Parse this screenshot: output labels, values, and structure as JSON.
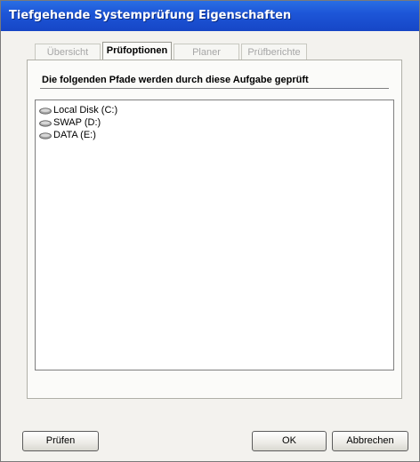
{
  "window": {
    "title": "Tiefgehende Systemprüfung Eigenschaften"
  },
  "tabs": [
    {
      "label": "Übersicht",
      "active": false
    },
    {
      "label": "Prüfoptionen",
      "active": true
    },
    {
      "label": "Planer",
      "active": false
    },
    {
      "label": "Prüfberichte",
      "active": false
    }
  ],
  "panel": {
    "heading": "Die folgenden Pfade werden durch diese Aufgabe geprüft",
    "drives": [
      {
        "label": "Local Disk (C:)",
        "icon": "drive-icon"
      },
      {
        "label": "SWAP (D:)",
        "icon": "drive-icon"
      },
      {
        "label": "DATA (E:)",
        "icon": "drive-icon"
      }
    ]
  },
  "buttons": {
    "check": "Prüfen",
    "ok": "OK",
    "cancel": "Abbrechen"
  },
  "colors": {
    "titlebar": "#1d56d8",
    "title_text": "#ffffff",
    "dialog_bg": "#f3f2ee"
  }
}
